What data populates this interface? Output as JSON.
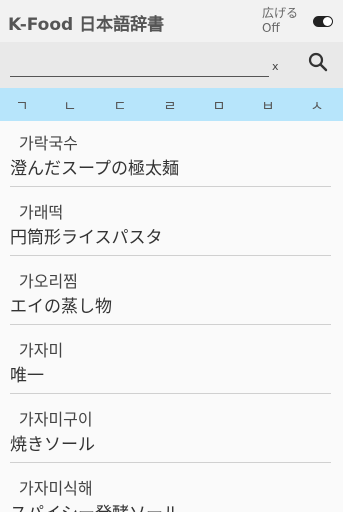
{
  "header": {
    "title": "K-Food  日本語辞書",
    "toggle_label_line1": "広げる",
    "toggle_label_line2": "Off"
  },
  "search": {
    "value": "",
    "placeholder": "",
    "clear_label": "x"
  },
  "index": [
    "ㄱ",
    "ㄴ",
    "ㄷ",
    "ㄹ",
    "ㅁ",
    "ㅂ",
    "ㅅ"
  ],
  "entries": [
    {
      "ko": "가락국수",
      "ja": "澄んだスープの極太麺"
    },
    {
      "ko": "가래떡",
      "ja": "円筒形ライスパスタ"
    },
    {
      "ko": "가오리찜",
      "ja": "エイの蒸し物"
    },
    {
      "ko": "가자미",
      "ja": "唯一"
    },
    {
      "ko": "가자미구이",
      "ja": "焼きソール"
    },
    {
      "ko": "가자미식해",
      "ja": "スパイシー発酵ソール"
    }
  ]
}
